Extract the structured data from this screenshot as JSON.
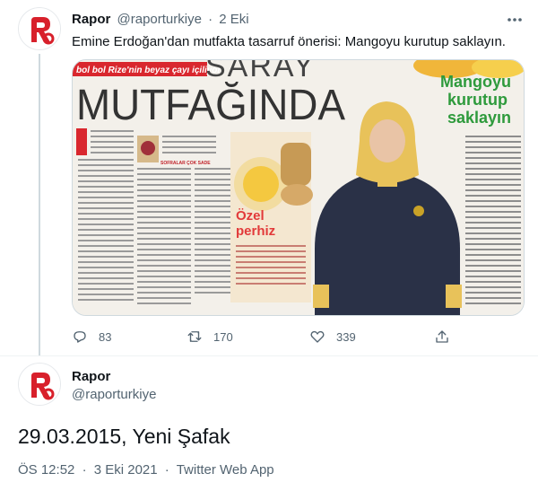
{
  "tweet1": {
    "author_name": "Rapor",
    "handle": "@raporturkiye",
    "separator": "·",
    "time_ago": "2 Eki",
    "text": "Emine Erdoğan'dan mutfakta tasarruf önerisi: Mangoyu kurutup saklayın.",
    "media": {
      "banner": "bol bol Rize'nin beyaz çayı içiliyor.",
      "headline_top": "SARAY",
      "headline": "MUTFAĞINDA",
      "green_heading": [
        "Mangoyu",
        "kurutup",
        "saklayın"
      ],
      "box_title": [
        "Özel",
        "perhiz"
      ],
      "subheading": "SOFRALAR ÇOK SADE"
    },
    "replies": "83",
    "retweets": "170",
    "likes": "339"
  },
  "tweet2": {
    "author_name": "Rapor",
    "handle": "@raporturkiye",
    "text": "29.03.2015, Yeni Şafak",
    "time": "ÖS 12:52",
    "separator": "·",
    "date": "3 Eki 2021",
    "source": "Twitter Web App"
  },
  "colors": {
    "brand_red": "#d8202b",
    "muted_text": "#536471",
    "banner_red": "#d9272e",
    "heading_green": "#2e9a3c",
    "coat_navy": "#2a3147",
    "headscarf_yellow": "#e8c25a"
  },
  "icons": [
    "rapor-logo",
    "more-icon",
    "reply-icon",
    "retweet-icon",
    "like-icon",
    "share-icon"
  ]
}
